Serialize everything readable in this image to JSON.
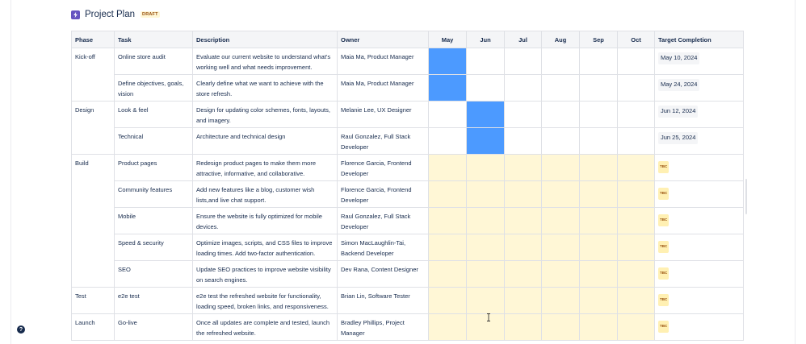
{
  "page": {
    "title": "Project Plan",
    "status_badge": "DRAFT"
  },
  "table": {
    "headers": {
      "phase": "Phase",
      "task": "Task",
      "description": "Description",
      "owner": "Owner",
      "months": [
        "May",
        "Jun",
        "Jul",
        "Aug",
        "Sep",
        "Oct"
      ],
      "target": "Target Completion"
    },
    "rows": [
      {
        "phase": "Kick-off",
        "task": "Online store audit",
        "description": "Evaluate our current website to understand what's working well and what needs improvement.",
        "owner": "Maia Ma, Product Manager",
        "target": "May 10, 2024",
        "months": [
          "blue",
          "",
          "",
          "",
          "",
          ""
        ]
      },
      {
        "phase": "",
        "task": "Define objectives, goals, vision",
        "description": "Clearly define what we want to achieve with the store refresh.",
        "owner": "Maia Ma, Product Manager",
        "target": "May 24, 2024",
        "months": [
          "blue",
          "",
          "",
          "",
          "",
          ""
        ]
      },
      {
        "phase": "Design",
        "task": "Look & feel",
        "description": "Design for updating color schemes, fonts, layouts, and imagery.",
        "owner": "Melanie Lee, UX Designer",
        "target": "Jun 12, 2024",
        "months": [
          "",
          "blue",
          "",
          "",
          "",
          ""
        ]
      },
      {
        "phase": "",
        "task": "Technical",
        "description": "Architecture and technical design",
        "owner": "Raul Gonzalez, Full Stack Developer",
        "target": "Jun 25, 2024",
        "months": [
          "",
          "blue",
          "",
          "",
          "",
          ""
        ]
      },
      {
        "phase": "Build",
        "task": "Product pages",
        "description": "Redesign product pages to make them more attractive, informative, and collaborative.",
        "owner": "Florence Garcia, Frontend Developer",
        "target": "TBC",
        "months": [
          "yellow",
          "yellow",
          "yellow",
          "yellow",
          "yellow",
          "yellow"
        ]
      },
      {
        "phase": "",
        "task": "Community features",
        "description": "Add new features like a blog, customer wish lists,and live chat support.",
        "owner": "Florence Garcia, Frontend Developer",
        "target": "TBC",
        "months": [
          "yellow",
          "yellow",
          "yellow",
          "yellow",
          "yellow",
          "yellow"
        ]
      },
      {
        "phase": "",
        "task": "Mobile",
        "description": "Ensure the website is fully optimized for mobile devices.",
        "owner": "Raul Gonzalez, Full Stack Developer",
        "target": "TBC",
        "months": [
          "yellow",
          "yellow",
          "yellow",
          "yellow",
          "yellow",
          "yellow"
        ]
      },
      {
        "phase": "",
        "task": "Speed & security",
        "description": "Optimize images, scripts, and CSS files to improve loading times. Add two-factor authentication.",
        "owner": "Simon MacLaughlin-Tai, Backend Developer",
        "target": "TBC",
        "months": [
          "yellow",
          "yellow",
          "yellow",
          "yellow",
          "yellow",
          "yellow"
        ]
      },
      {
        "phase": "",
        "task": "SEO",
        "description": "Update SEO practices to improve website visibility on search engines.",
        "owner": "Dev Rana, Content Designer",
        "target": "TBC",
        "months": [
          "yellow",
          "yellow",
          "yellow",
          "yellow",
          "yellow",
          "yellow"
        ]
      },
      {
        "phase": "Test",
        "task": "e2e test",
        "description": "e2e test the refreshed website for functionality, loading speed, broken links, and responsiveness.",
        "owner": "Brian Lin, Software Tester",
        "target": "TBC",
        "months": [
          "yellow",
          "yellow",
          "yellow",
          "yellow",
          "yellow",
          "yellow"
        ]
      },
      {
        "phase": "Launch",
        "task": "Go-live",
        "description": "Once all updates are complete and tested, launch the refreshed website.",
        "owner": "Bradley Phillips, Project Manager",
        "target": "TBC",
        "months": [
          "yellow",
          "yellow",
          "yellow",
          "yellow",
          "yellow",
          "yellow"
        ]
      }
    ]
  },
  "help": {
    "label": "?"
  },
  "icons": {
    "title_icon": "lightning-icon",
    "help": "help-icon",
    "cursor": "text-cursor-icon"
  },
  "colors": {
    "blue_fill": "#4c9aff",
    "yellow_fill": "#fff7d6",
    "badge_bg": "#fff0b3",
    "accent": "#6554c0"
  }
}
